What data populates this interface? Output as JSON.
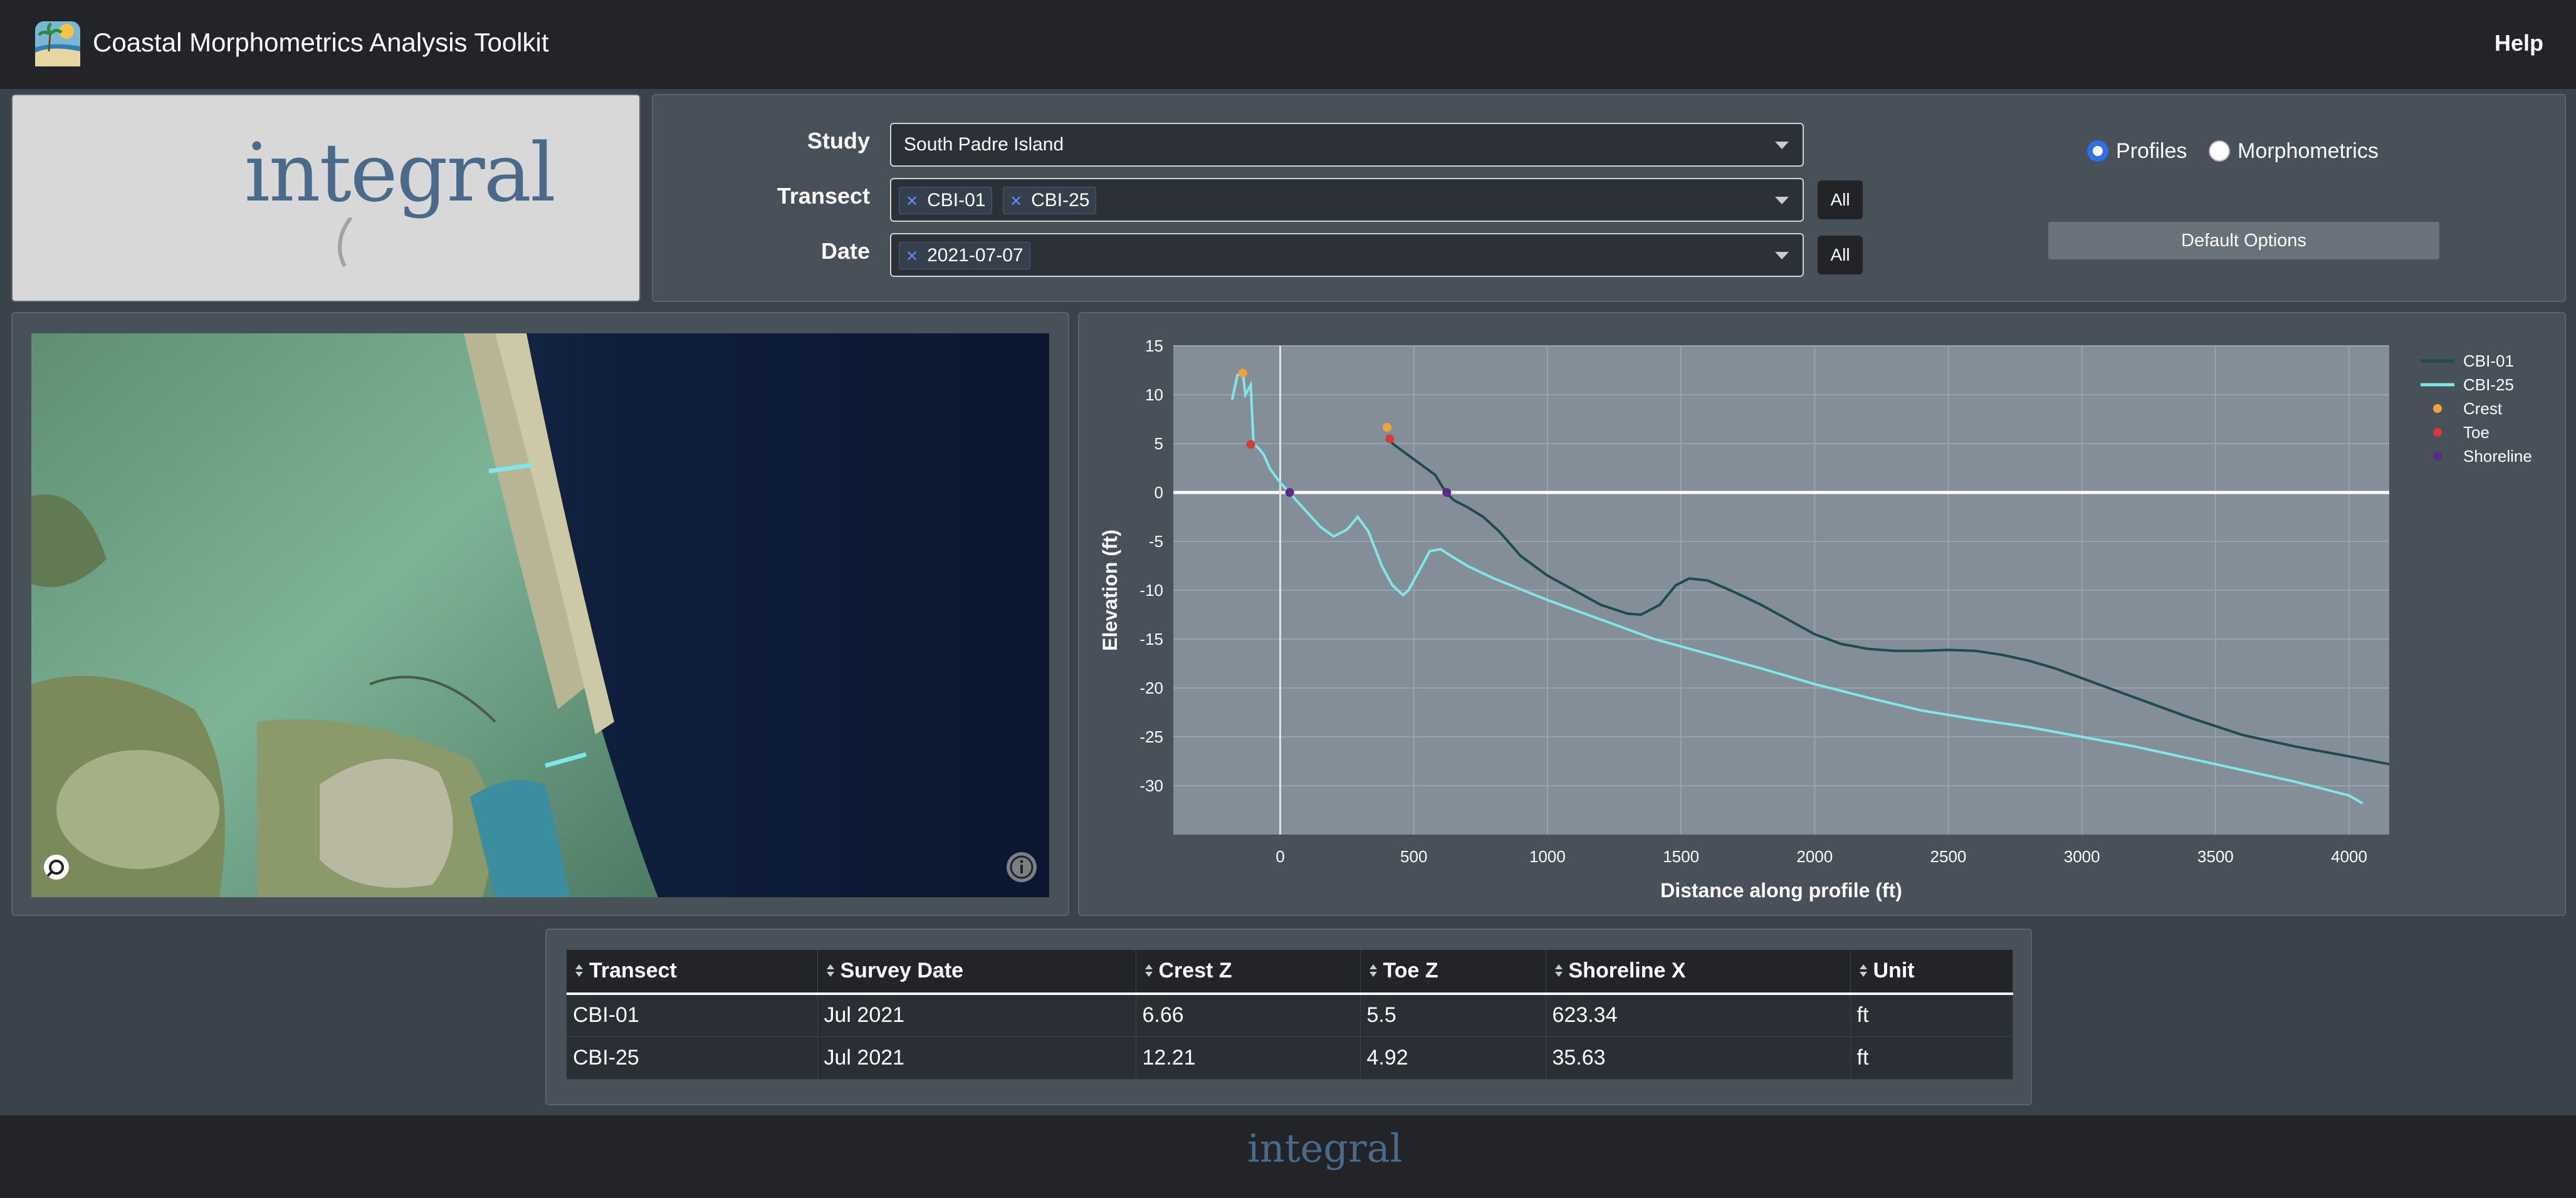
{
  "header": {
    "title": "Coastal Morphometrics Analysis Toolkit",
    "help": "Help"
  },
  "logo": {
    "text": "integral"
  },
  "controls": {
    "study_label": "Study",
    "study_value": "South Padre Island",
    "transect_label": "Transect",
    "transect_tags": [
      "CBI-01",
      "CBI-25"
    ],
    "date_label": "Date",
    "date_tags": [
      "2021-07-07"
    ],
    "all_label": "All",
    "view_options": [
      {
        "label": "Profiles",
        "selected": true
      },
      {
        "label": "Morphometrics",
        "selected": false
      }
    ],
    "default_options_label": "Default Options"
  },
  "chart_data": {
    "type": "line",
    "xlabel": "Distance along profile (ft)",
    "ylabel": "Elevation (ft)",
    "xlim": [
      -400,
      4150
    ],
    "ylim": [
      -35,
      15
    ],
    "xticks": [
      0,
      500,
      1000,
      1500,
      2000,
      2500,
      3000,
      3500,
      4000
    ],
    "yticks": [
      15,
      10,
      5,
      0,
      -5,
      -10,
      -15,
      -20,
      -25,
      -30
    ],
    "grid": true,
    "legend_position": "right",
    "colors": {
      "CBI-01": "#1f4a4f",
      "CBI-25": "#7fe7ea",
      "Crest": "#f2a33a",
      "Toe": "#d63b3b",
      "Shoreline": "#5b2a86"
    },
    "series": [
      {
        "name": "CBI-01",
        "x": [
          400,
          430,
          470,
          520,
          580,
          620,
          650,
          700,
          760,
          820,
          900,
          1000,
          1100,
          1200,
          1300,
          1350,
          1420,
          1480,
          1530,
          1600,
          1700,
          1800,
          1900,
          2000,
          2100,
          2200,
          2300,
          2400,
          2500,
          2600,
          2700,
          2800,
          2900,
          3000,
          3200,
          3400,
          3600,
          3800,
          4000,
          4150
        ],
        "y": [
          5.5,
          4.8,
          4.0,
          3.0,
          1.8,
          0.0,
          -0.8,
          -1.5,
          -2.5,
          -4.0,
          -6.5,
          -8.5,
          -10.0,
          -11.5,
          -12.4,
          -12.5,
          -11.5,
          -9.5,
          -8.8,
          -9.0,
          -10.2,
          -11.5,
          -13.0,
          -14.5,
          -15.5,
          -16.0,
          -16.2,
          -16.2,
          -16.1,
          -16.2,
          -16.6,
          -17.2,
          -18.0,
          -19.0,
          -21.0,
          -23.0,
          -24.8,
          -26.0,
          -27.0,
          -27.8
        ]
      },
      {
        "name": "CBI-25",
        "x": [
          -180,
          -160,
          -140,
          -130,
          -110,
          -100,
          -80,
          -60,
          -40,
          0,
          35,
          60,
          100,
          150,
          200,
          250,
          290,
          330,
          380,
          420,
          460,
          480,
          520,
          560,
          600,
          640,
          700,
          800,
          1000,
          1200,
          1400,
          1600,
          1800,
          2000,
          2200,
          2400,
          2600,
          2800,
          3000,
          3200,
          3400,
          3600,
          3800,
          4000,
          4050
        ],
        "y": [
          9.5,
          12.0,
          12.2,
          10.0,
          11.0,
          5.0,
          4.5,
          3.8,
          2.5,
          1.0,
          0.0,
          -0.8,
          -2.0,
          -3.5,
          -4.5,
          -3.8,
          -2.5,
          -4.0,
          -7.5,
          -9.5,
          -10.5,
          -10.0,
          -8.0,
          -6.0,
          -5.8,
          -6.5,
          -7.5,
          -8.8,
          -11.0,
          -13.0,
          -15.0,
          -16.5,
          -18.0,
          -19.6,
          -21.0,
          -22.3,
          -23.2,
          -24.0,
          -25.0,
          -26.0,
          -27.2,
          -28.4,
          -29.6,
          -31.0,
          -31.8
        ]
      },
      {
        "name": "Crest",
        "points": [
          {
            "x": 400,
            "y": 6.66
          },
          {
            "x": -140,
            "y": 12.21
          }
        ]
      },
      {
        "name": "Toe",
        "points": [
          {
            "x": 410,
            "y": 5.5
          },
          {
            "x": -110,
            "y": 4.92
          }
        ]
      },
      {
        "name": "Shoreline",
        "points": [
          {
            "x": 623.34,
            "y": 0
          },
          {
            "x": 35.63,
            "y": 0
          }
        ]
      }
    ]
  },
  "table": {
    "headers": [
      "Transect",
      "Survey Date",
      "Crest Z",
      "Toe Z",
      "Shoreline X",
      "Unit"
    ],
    "rows": [
      [
        "CBI-01",
        "Jul 2021",
        "6.66",
        "5.5",
        "623.34",
        "ft"
      ],
      [
        "CBI-25",
        "Jul 2021",
        "12.21",
        "4.92",
        "35.63",
        "ft"
      ]
    ]
  },
  "footer": {
    "logo_text": "integral"
  },
  "icons": {
    "app": "beach-icon",
    "map_left": "layers-icon",
    "map_right": "info-icon",
    "sort": "sort-icon"
  }
}
